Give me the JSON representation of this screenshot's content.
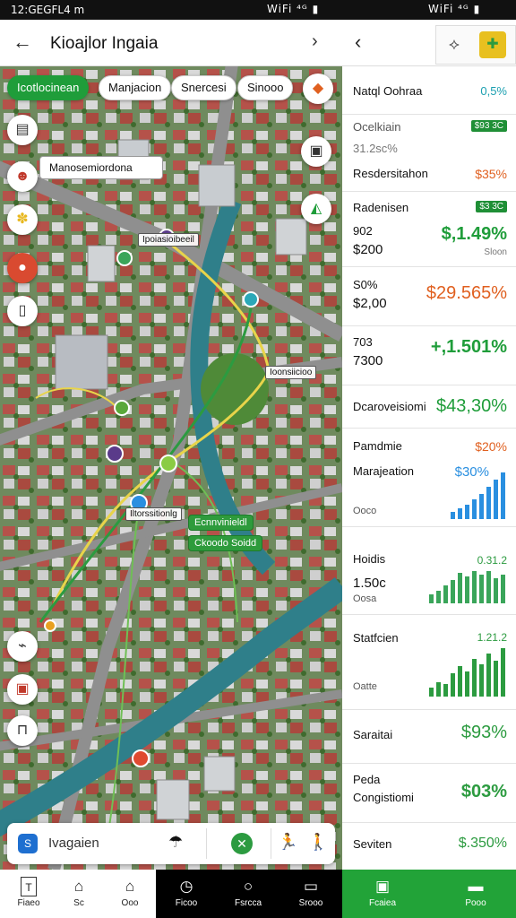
{
  "status": {
    "time": "12:GEGFL4 m",
    "icons_left": "WiFi ⁴ᴳ ▮",
    "icons_right": "WiFi ⁴ᴳ ▮"
  },
  "left_header": {
    "title": "Kioajlor Ingaia",
    "back_icon": "arrow-left-icon",
    "forward_icon": "chevron-right-icon"
  },
  "chips": [
    {
      "label": "Icotlocinean",
      "active": true
    },
    {
      "label": "Manjacion",
      "active": false
    },
    {
      "label": "Snercesi",
      "active": false
    },
    {
      "label": "Sinooo",
      "active": false
    }
  ],
  "map_callout": "Manosemiordona",
  "map_labels": [
    {
      "text": "Ipoiasioibeeil"
    },
    {
      "text": "Ioonsiicioo"
    },
    {
      "text": "Iltorssitionlg"
    },
    {
      "text": "Ecnnvinieldl"
    },
    {
      "text": "Ckoodo Soidd"
    }
  ],
  "search": {
    "placeholder": "Ivagaien"
  },
  "bottom_nav": [
    {
      "label": "Fiaeo",
      "icon": "T"
    },
    {
      "label": "Sc",
      "icon": "⌂"
    },
    {
      "label": "Ooo",
      "icon": "⌂"
    },
    {
      "label": "Ficoo",
      "icon": "◷"
    },
    {
      "label": "Fsrcca",
      "icon": "○"
    },
    {
      "label": "Srooo",
      "icon": "▭"
    }
  ],
  "right_panel": {
    "header_title": "Natql Oohraa",
    "header_value": "0,5%",
    "rows": [
      {
        "name": "Ocelkiain",
        "pill": "$93 3C",
        "sub": "31.2sc%",
        "name2": "Resdersitahon",
        "v2": "$35%"
      },
      {
        "name": "Radenisen",
        "pill": "$3 3C",
        "l1": "902",
        "l2": "$200",
        "big": "$,1.49%",
        "small": "Sloon"
      },
      {
        "l1": "S0%",
        "l2": "$2,00",
        "big": "$29.565%"
      },
      {
        "l1": "703",
        "l2": "7300",
        "big": "+,1.501%"
      },
      {
        "name": "Dcaroveisiomi",
        "big": "$43,30%"
      },
      {
        "name": "Pamdmie",
        "v": "$20%",
        "name2": "Marajeation",
        "big": "$30%",
        "name3": "Ooco"
      },
      {
        "name": "Hoidis",
        "v": "0.31.2",
        "l2": "1.50c",
        "name3": "Oosa"
      },
      {
        "name": "Statfcien",
        "v": "1.21.2",
        "name3": "Oatte"
      },
      {
        "name": "Saraitai",
        "big": "$93%"
      },
      {
        "name": "Peda",
        "name2": "Congistiomi",
        "big": "$03%"
      },
      {
        "name": "Seviten",
        "big": "$.350%"
      }
    ],
    "bottom": [
      {
        "label": "Fcaiea"
      },
      {
        "label": "Pooo"
      }
    ]
  },
  "colors": {
    "green": "#1f9d3a",
    "orange": "#e06020",
    "blue": "#2a8fe0"
  }
}
